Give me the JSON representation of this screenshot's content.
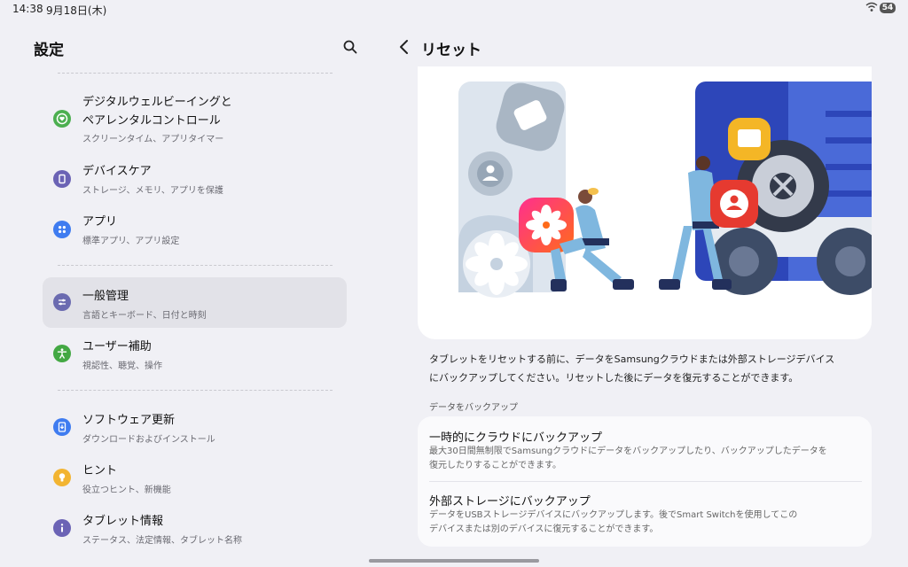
{
  "status_bar": {
    "time": "14:38",
    "date": "9月18日(木)",
    "battery": "54"
  },
  "left_panel": {
    "title": "設定",
    "items": [
      {
        "title1": "デジタルウェルビーイングと",
        "title2": "ペアレンタルコントロール",
        "subtitle": "スクリーンタイム、アプリタイマー",
        "icon": "heart-icon",
        "color": "#4caf50"
      },
      {
        "title": "デバイスケア",
        "subtitle": "ストレージ、メモリ、アプリを保護",
        "icon": "device-care-icon",
        "color": "#6b63b5"
      },
      {
        "title": "アプリ",
        "subtitle": "標準アプリ、アプリ設定",
        "icon": "apps-icon",
        "color": "#3f7cf0"
      },
      {
        "title": "一般管理",
        "subtitle": "言語とキーボード、日付と時刻",
        "icon": "sliders-icon",
        "color": "#6b6bb0",
        "selected": true
      },
      {
        "title": "ユーザー補助",
        "subtitle": "視認性、聴覚、操作",
        "icon": "accessibility-icon",
        "color": "#43a843"
      },
      {
        "title": "ソフトウェア更新",
        "subtitle": "ダウンロードおよびインストール",
        "icon": "update-icon",
        "color": "#3f7cf0"
      },
      {
        "title": "ヒント",
        "subtitle": "役立つヒント、新機能",
        "icon": "lightbulb-icon",
        "color": "#f2b431"
      },
      {
        "title": "タブレット情報",
        "subtitle": "ステータス、法定情報、タブレット名称",
        "icon": "info-icon",
        "color": "#6b63b5"
      }
    ]
  },
  "right_panel": {
    "title": "リセット",
    "description_line1": "タブレットをリセットする前に、データをSamsungクラウドまたは外部ストレージデバイス",
    "description_line2": "にバックアップしてください。リセットした後にデータを復元することができます。",
    "section_label": "データをバックアップ",
    "options": [
      {
        "title": "一時的にクラウドにバックアップ",
        "desc_line1": "最大30日間無制限でSamsungクラウドにデータをバックアップしたり、バックアップしたデータを",
        "desc_line2": "復元したりすることができます。"
      },
      {
        "title": "外部ストレージにバックアップ",
        "desc_line1": "データをUSBストレージデバイスにバックアップします。後でSmart Switchを使用してこの",
        "desc_line2": "デバイスまたは別のデバイスに復元することができます。"
      }
    ]
  }
}
